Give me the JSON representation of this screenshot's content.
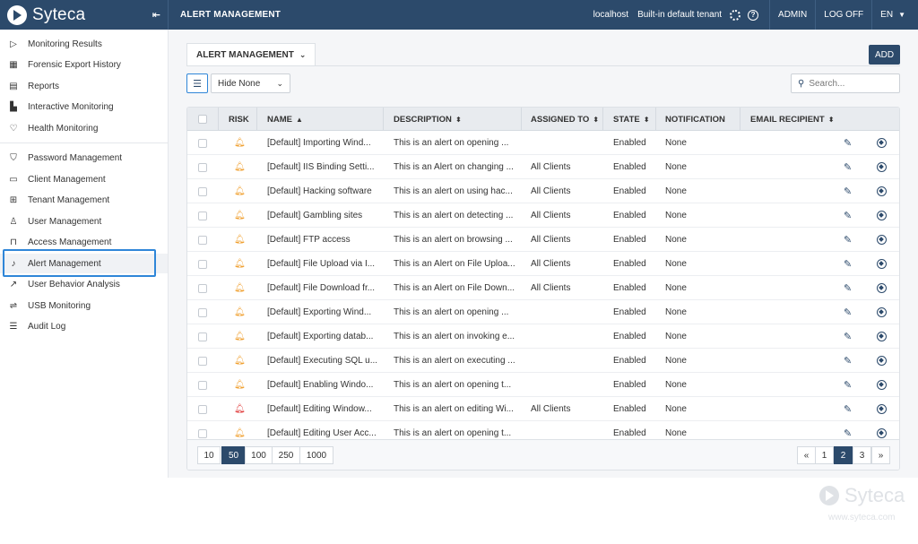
{
  "app": {
    "brand": "Syteca",
    "page_heading": "ALERT MANAGEMENT",
    "collapse_glyph": "⇤"
  },
  "topbar": {
    "server": "localhost",
    "tenant": "Built-in default tenant",
    "user": "ADMIN",
    "logoff": "LOG OFF",
    "language": "EN"
  },
  "sidebar": {
    "items": [
      {
        "label": "Monitoring Results",
        "icon": "play-icon",
        "glyph": "▷"
      },
      {
        "label": "Forensic Export History",
        "icon": "film-icon",
        "glyph": "▦"
      },
      {
        "label": "Reports",
        "icon": "report-icon",
        "glyph": "▤"
      },
      {
        "label": "Interactive Monitoring",
        "icon": "chart-icon",
        "glyph": "▙"
      },
      {
        "label": "Health Monitoring",
        "icon": "heart-icon",
        "glyph": "♡"
      },
      {
        "label": "Password Management",
        "icon": "shield-icon",
        "glyph": "⛉"
      },
      {
        "label": "Client Management",
        "icon": "monitor-icon",
        "glyph": "▭"
      },
      {
        "label": "Tenant Management",
        "icon": "hierarchy-icon",
        "glyph": "⊞"
      },
      {
        "label": "User Management",
        "icon": "user-icon",
        "glyph": "♙"
      },
      {
        "label": "Access Management",
        "icon": "lock-icon",
        "glyph": "⊓"
      },
      {
        "label": "Alert Management",
        "icon": "bell-icon",
        "glyph": "♪"
      },
      {
        "label": "User Behavior Analysis",
        "icon": "trend-icon",
        "glyph": "↗"
      },
      {
        "label": "USB Monitoring",
        "icon": "usb-icon",
        "glyph": "⇌"
      },
      {
        "label": "Audit Log",
        "icon": "list-icon",
        "glyph": "☰"
      }
    ]
  },
  "toolbar": {
    "tab_label": "ALERT MANAGEMENT",
    "add_label": "ADD",
    "hide_label": "Hide None",
    "search_placeholder": "Search..."
  },
  "table": {
    "columns": [
      "RISK",
      "NAME",
      "DESCRIPTION",
      "ASSIGNED TO",
      "STATE",
      "NOTIFICATION",
      "EMAIL RECIPIENT"
    ],
    "rows": [
      {
        "risk": "medium",
        "name": "[Default] Importing Wind...",
        "description": "This is an alert on opening ...",
        "assigned": "",
        "state": "Enabled",
        "notification": "None"
      },
      {
        "risk": "medium",
        "name": "[Default] IIS Binding Setti...",
        "description": "This is an Alert on changing ...",
        "assigned": "All Clients",
        "state": "Enabled",
        "notification": "None"
      },
      {
        "risk": "medium",
        "name": "[Default] Hacking software",
        "description": "This is an alert on using hac...",
        "assigned": "All Clients",
        "state": "Enabled",
        "notification": "None"
      },
      {
        "risk": "medium",
        "name": "[Default] Gambling sites",
        "description": "This is an alert on detecting ...",
        "assigned": "All Clients",
        "state": "Enabled",
        "notification": "None"
      },
      {
        "risk": "medium",
        "name": "[Default] FTP access",
        "description": "This is an alert on browsing ...",
        "assigned": "All Clients",
        "state": "Enabled",
        "notification": "None"
      },
      {
        "risk": "medium",
        "name": "[Default] File Upload via I...",
        "description": "This is an Alert on File Uploa...",
        "assigned": "All Clients",
        "state": "Enabled",
        "notification": "None"
      },
      {
        "risk": "medium",
        "name": "[Default] File Download fr...",
        "description": "This is an Alert on File Down...",
        "assigned": "All Clients",
        "state": "Enabled",
        "notification": "None"
      },
      {
        "risk": "medium",
        "name": "[Default] Exporting Wind...",
        "description": "This is an alert on opening ...",
        "assigned": "",
        "state": "Enabled",
        "notification": "None"
      },
      {
        "risk": "medium",
        "name": "[Default] Exporting datab...",
        "description": "This is an alert on invoking e...",
        "assigned": "",
        "state": "Enabled",
        "notification": "None"
      },
      {
        "risk": "medium",
        "name": "[Default] Executing SQL u...",
        "description": "This is an alert on executing ...",
        "assigned": "",
        "state": "Enabled",
        "notification": "None"
      },
      {
        "risk": "medium",
        "name": "[Default] Enabling Windo...",
        "description": "This is an alert on opening t...",
        "assigned": "",
        "state": "Enabled",
        "notification": "None"
      },
      {
        "risk": "high",
        "name": "[Default] Editing Window...",
        "description": "This is an alert on editing Wi...",
        "assigned": "All Clients",
        "state": "Enabled",
        "notification": "None"
      },
      {
        "risk": "medium",
        "name": "[Default] Editing User Acc...",
        "description": "This is an alert on opening t...",
        "assigned": "",
        "state": "Enabled",
        "notification": "None"
      }
    ]
  },
  "pagination": {
    "page_sizes": [
      "10",
      "50",
      "100",
      "250",
      "1000"
    ],
    "selected_size": "50",
    "prev": "«",
    "pages": [
      "1",
      "2",
      "3"
    ],
    "current_page": "2",
    "next": "»"
  },
  "watermark": {
    "name": "Syteca",
    "url": "www.syteca.com"
  },
  "colors": {
    "header_bg": "#2c4a6b",
    "accent_blue": "#2f86d8",
    "risk_medium": "#f0a030",
    "risk_high": "#e03b3b"
  }
}
